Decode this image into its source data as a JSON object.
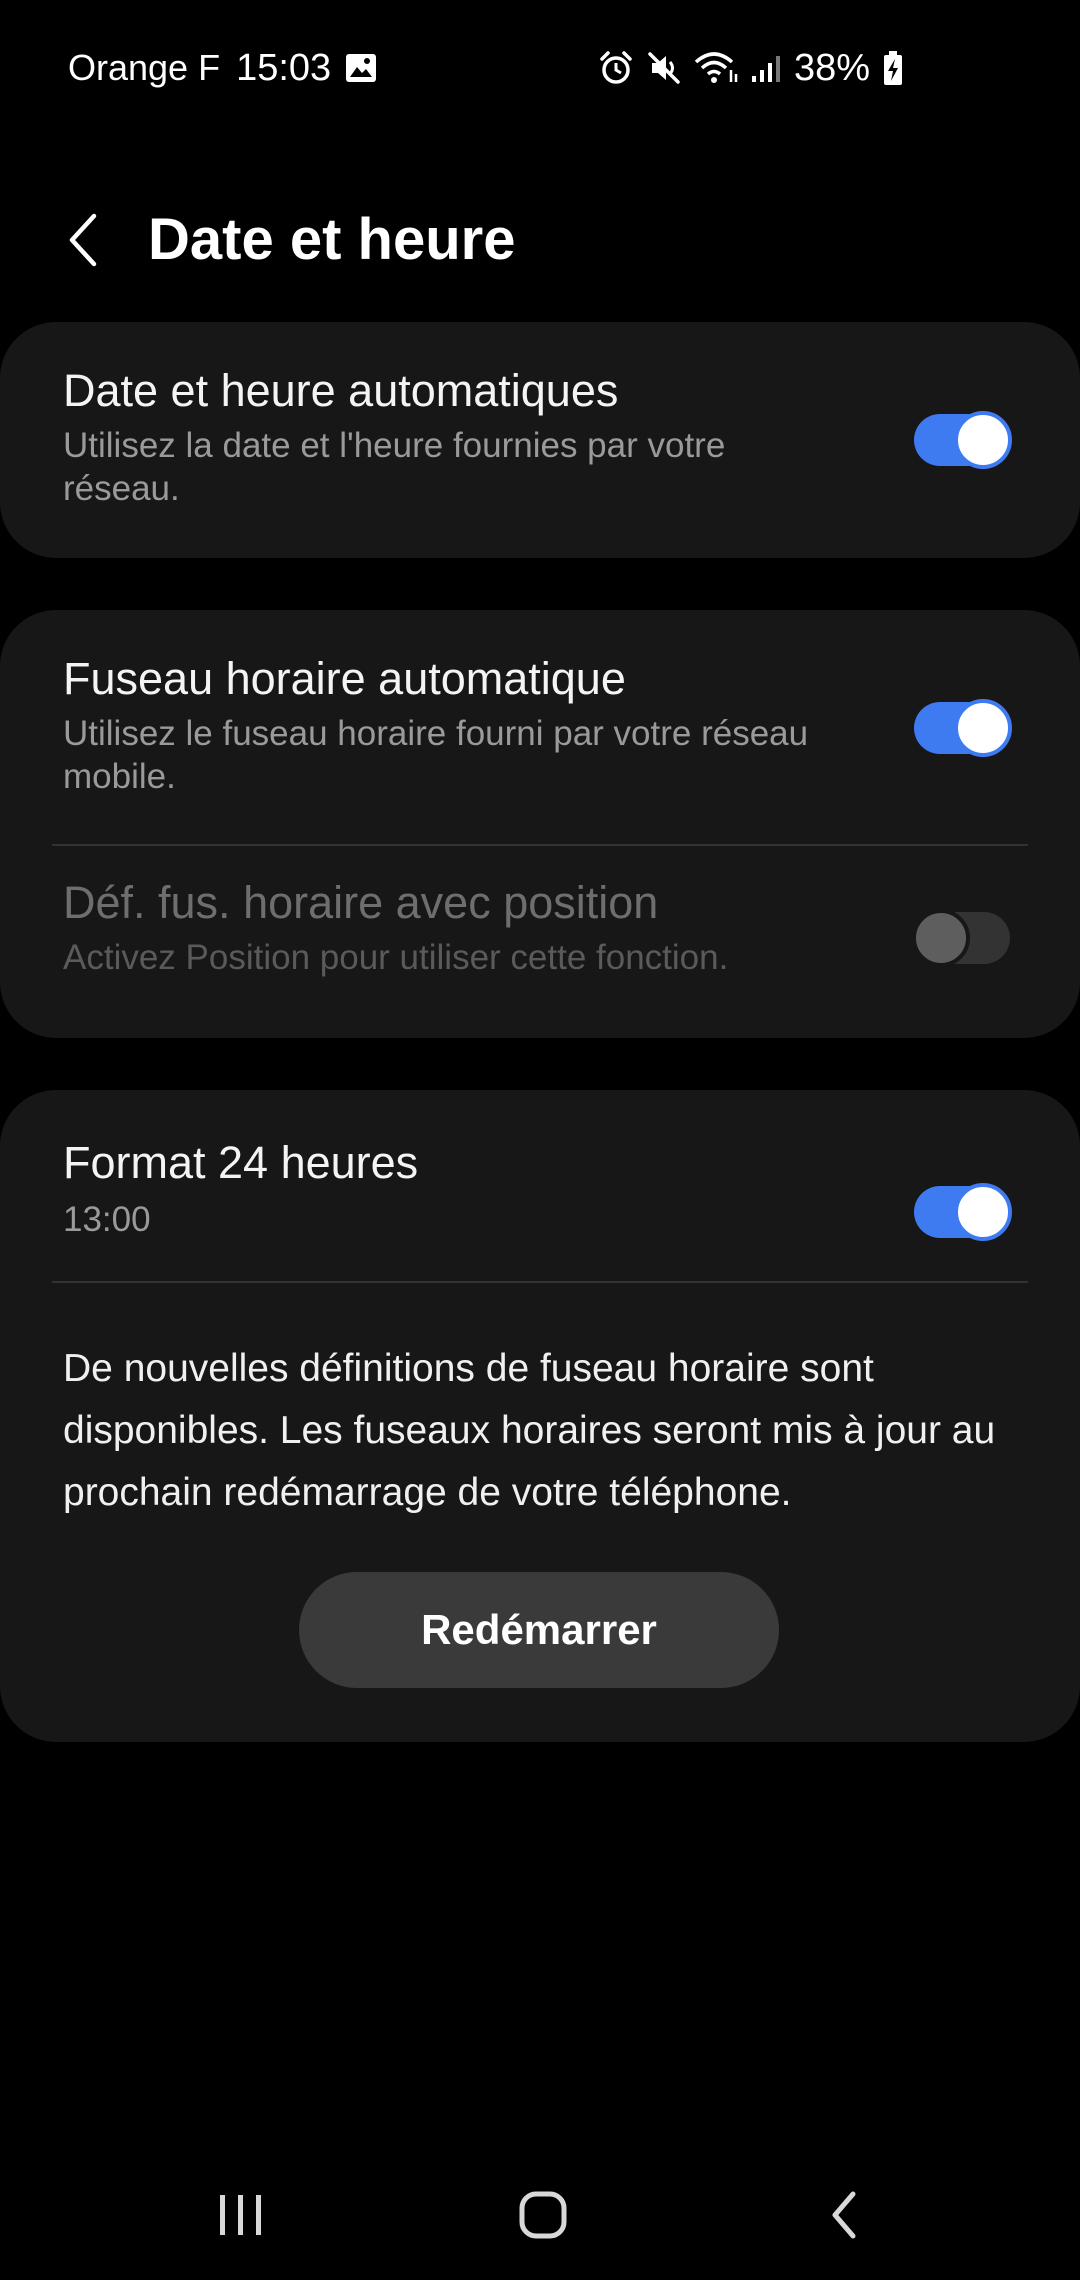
{
  "status_bar": {
    "carrier": "Orange F",
    "time": "15:03",
    "battery": "38%",
    "icons": [
      "image-icon",
      "alarm-icon",
      "mute-icon",
      "wifi-icon",
      "signal-icon",
      "battery-charging-icon"
    ]
  },
  "header": {
    "title": "Date et heure",
    "back_icon": "chevron-left-icon"
  },
  "settings": {
    "auto_datetime": {
      "title": "Date et heure automatiques",
      "subtitle": "Utilisez la date et l'heure fournies par votre réseau.",
      "enabled": true
    },
    "auto_timezone": {
      "title": "Fuseau horaire automatique",
      "subtitle": "Utilisez le fuseau horaire fourni par votre réseau mobile.",
      "enabled": true
    },
    "timezone_location": {
      "title": "Déf. fus. horaire avec position",
      "subtitle": "Activez Position pour utiliser cette fonction.",
      "enabled": false,
      "disabled": true
    },
    "format_24h": {
      "title": "Format 24 heures",
      "subtitle": "13:00",
      "enabled": true
    }
  },
  "notice": {
    "text": "De nouvelles définitions de fuseau horaire sont disponibles. Les fuseaux horaires seront mis à jour au prochain redémarrage de votre téléphone.",
    "button_label": "Redémarrer"
  },
  "nav_bar": {
    "buttons": [
      "recents-icon",
      "home-icon",
      "back-icon"
    ]
  },
  "colors": {
    "accent": "#3e7bf1",
    "background": "#000000",
    "card": "#171717",
    "button": "#3a3a3a"
  }
}
